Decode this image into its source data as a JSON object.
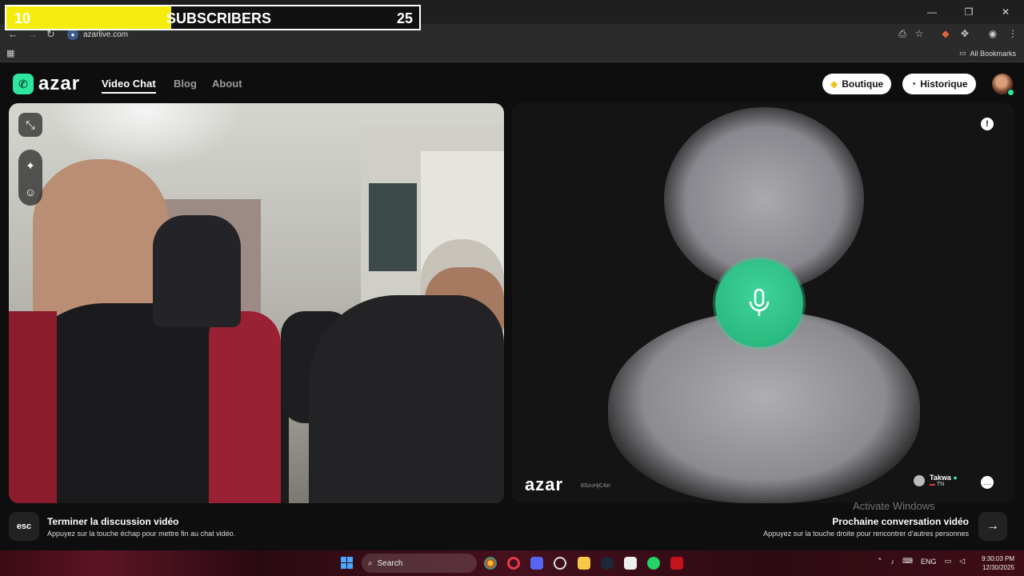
{
  "browser": {
    "url": "azarlive.com",
    "bookmarks_label": "All Bookmarks"
  },
  "overlay": {
    "count": "10",
    "label": "SUBSCRIBERS",
    "goal": "25",
    "progress_fraction": 0.4,
    "fill_color": "#f5ec0e"
  },
  "header": {
    "logo": "azar",
    "nav": [
      {
        "label": "Video Chat",
        "active": true
      },
      {
        "label": "Blog",
        "active": false
      },
      {
        "label": "About",
        "active": false
      }
    ],
    "boutique_label": "Boutique",
    "historique_label": "Historique"
  },
  "remote": {
    "logo": "azar",
    "session_id": "8SzuHjC4zr",
    "partner_name": "Takwa",
    "partner_country": "TN",
    "accent_color": "#2ee6a0"
  },
  "actions": {
    "esc_key": "esc",
    "end_title": "Terminer la discussion vidéo",
    "end_subtitle": "Appuyez sur la touche échap pour mettre fin au chat vidéo.",
    "next_title": "Prochaine conversation vidéo",
    "next_subtitle": "Appuyez sur la touche droite pour rencontrer d'autres personnes"
  },
  "watermark": "Activate Windows",
  "taskbar": {
    "search_placeholder": "Search",
    "language": "ENG",
    "time": "9:30:03 PM",
    "date": "12/30/2025"
  }
}
